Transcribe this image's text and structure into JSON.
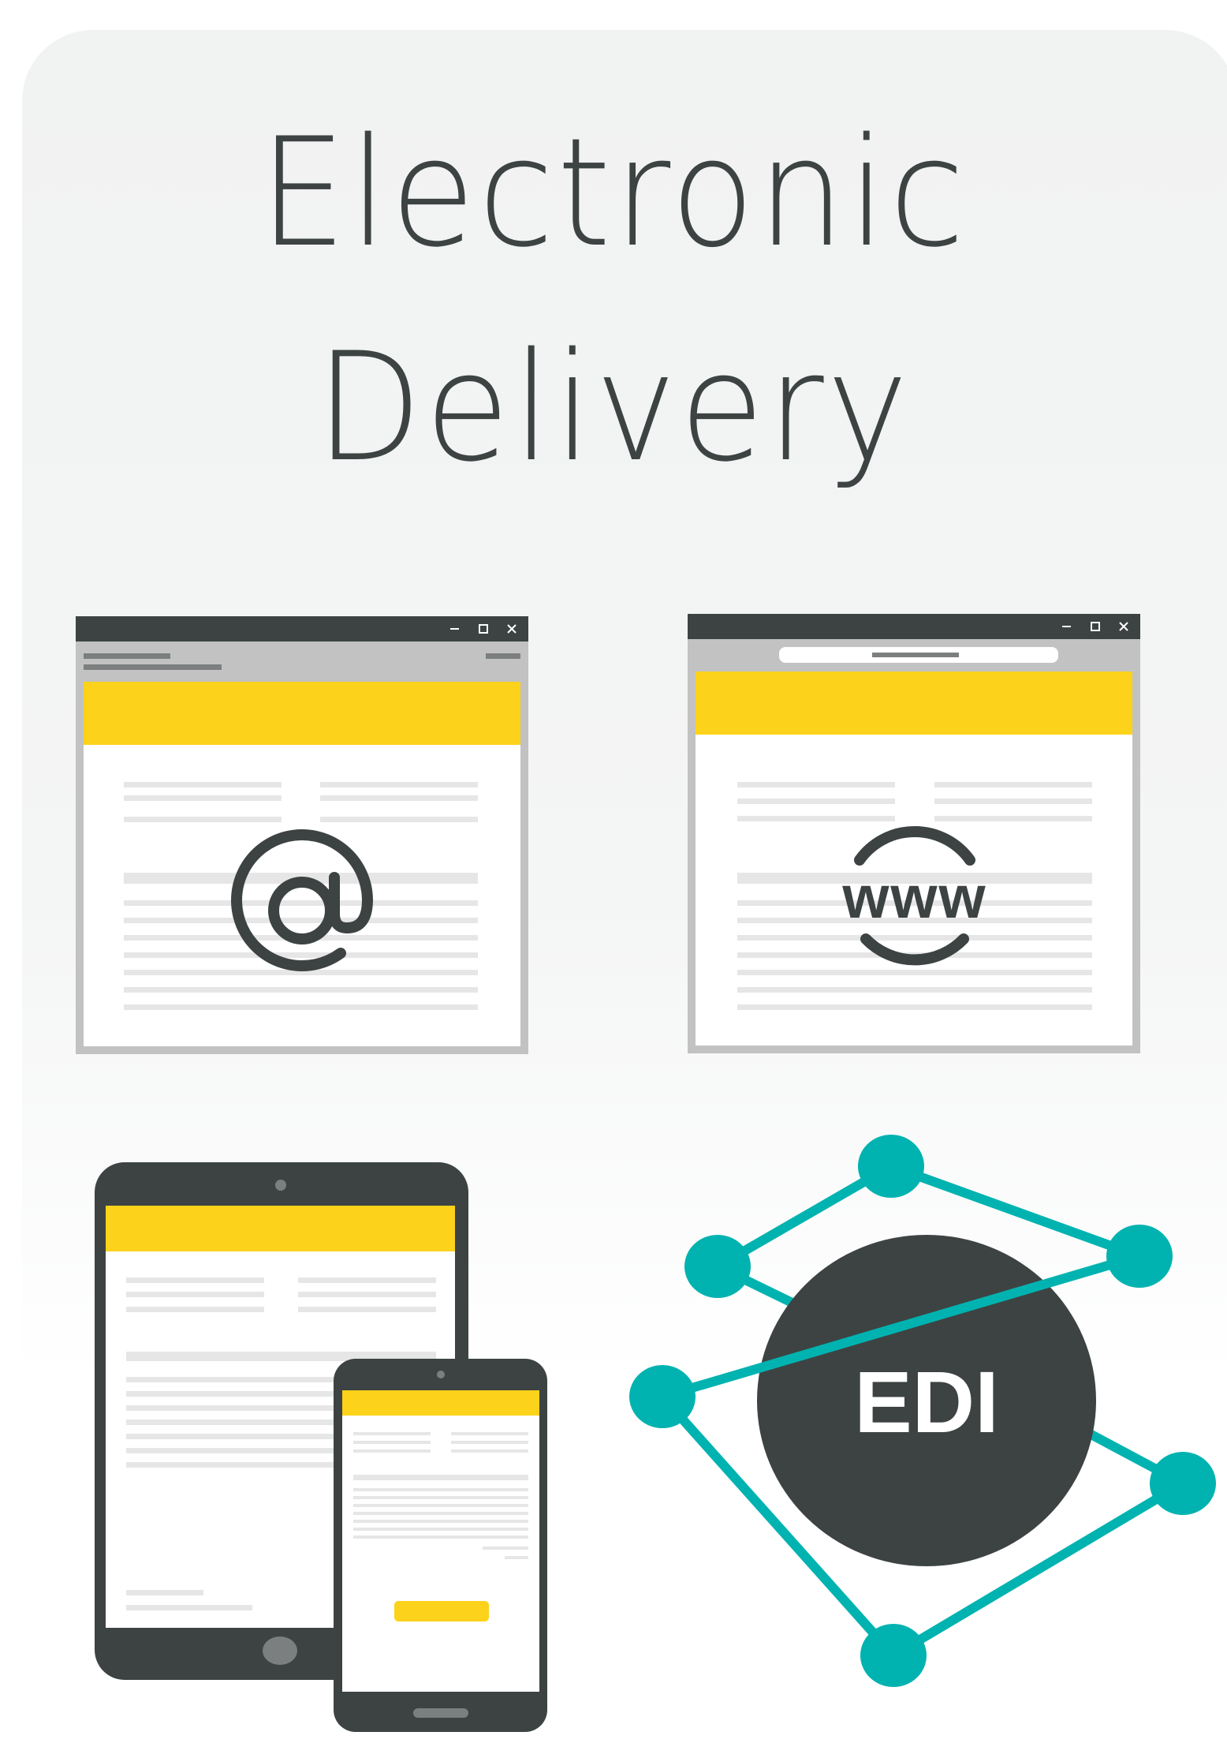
{
  "title": {
    "line1": "Electronic",
    "line2": "Delivery"
  },
  "icons": {
    "email": "at-sign-icon",
    "web": "www-icon",
    "mobile": "tablet-and-phone-icon",
    "edi": "edi-network-icon"
  },
  "edi": {
    "label": "EDI"
  },
  "web": {
    "label": "www"
  },
  "colors": {
    "dark": "#3d4343",
    "yellow": "#fdd21b",
    "teal": "#00b3b0",
    "gray": "#c2c2c2"
  }
}
